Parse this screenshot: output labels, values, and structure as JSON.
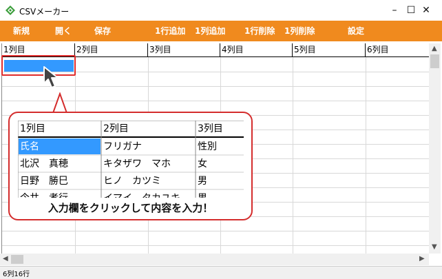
{
  "window": {
    "title": "CSVメーカー",
    "minimize": "–",
    "maximize": "☐",
    "close": "✕"
  },
  "toolbar": {
    "new": "新規",
    "open": "開く",
    "save": "保存",
    "add_row": "1行追加",
    "add_col": "1列追加",
    "delete_row": "1行削除",
    "delete_col": "1列削除",
    "settings": "設定",
    "color": "#f08a1e"
  },
  "grid": {
    "headers": [
      "1列目",
      "2列目",
      "3列目",
      "4列目",
      "5列目",
      "6列目"
    ],
    "selected_cell_color": "#3399ff"
  },
  "callout": {
    "headers": [
      "1列目",
      "2列目",
      "3列目"
    ],
    "rows": [
      [
        "氏名",
        "フリガナ",
        "性別"
      ],
      [
        "北沢　真穂",
        "キタザワ　マホ",
        "女"
      ],
      [
        "日野　勝巳",
        "ヒノ　カツミ",
        "男"
      ],
      [
        "今井　孝行",
        "イマイ　タカユキ",
        "男"
      ]
    ],
    "caption": "入力欄をクリックして内容を入力！",
    "border_color": "#d42c2c"
  },
  "status": {
    "text": "6列16行"
  }
}
